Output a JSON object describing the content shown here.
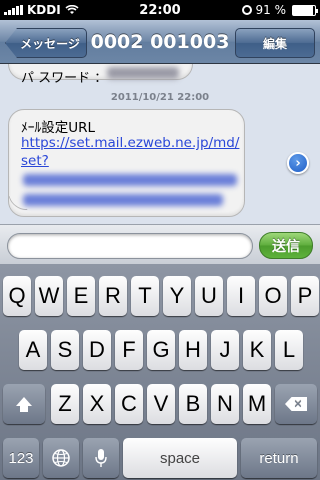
{
  "status_bar": {
    "carrier": "KDDI",
    "time": "22:00",
    "battery": "91 %",
    "battery_level": 0.91
  },
  "nav": {
    "back_label": "メッセージ",
    "title": "0002 001003",
    "edit_label": "編集"
  },
  "messages": {
    "prev_partial_label": "パ スワード ：",
    "timestamp": "2011/10/21 22:00",
    "bubble_heading": "ﾒｰﾙ設定URL",
    "bubble_link": "https://set.mail.ezweb.ne.jp/md/set?"
  },
  "input_bar": {
    "text_value": "",
    "send_label": "送信"
  },
  "keyboard": {
    "row1": [
      "Q",
      "W",
      "E",
      "R",
      "T",
      "Y",
      "U",
      "I",
      "O",
      "P"
    ],
    "row2": [
      "A",
      "S",
      "D",
      "F",
      "G",
      "H",
      "J",
      "K",
      "L"
    ],
    "row3": [
      "Z",
      "X",
      "C",
      "V",
      "B",
      "N",
      "M"
    ],
    "numbers_label": "123",
    "space_label": "space",
    "return_label": "return"
  },
  "icons": {
    "globe": "globe-icon",
    "mic": "microphone-icon",
    "shift": "shift-icon",
    "delete": "delete-icon",
    "detail": "chevron-right-icon",
    "wifi": "wifi-icon"
  },
  "colors": {
    "link": "#2a47d8",
    "send": "#5ead3c",
    "nav": "#6d86a6"
  }
}
